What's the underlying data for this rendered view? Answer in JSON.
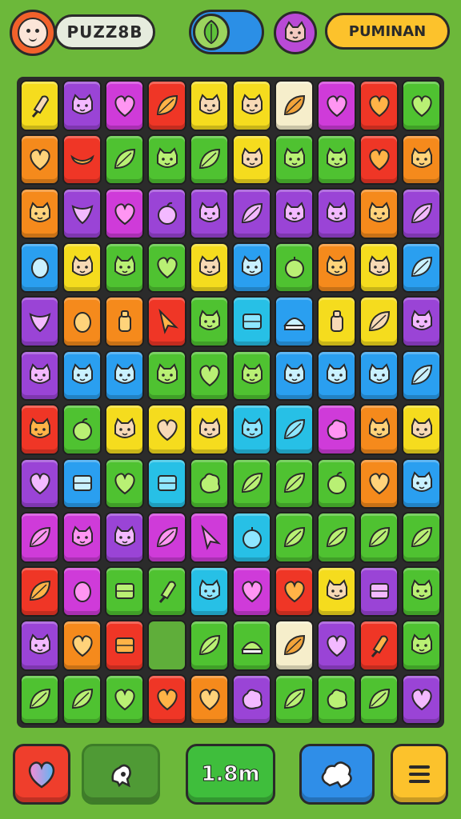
{
  "header": {
    "title": "PUZZ8B",
    "badge": "PUMINAN",
    "colors": {
      "avatar": "#f2612b",
      "toggle": "#2b8fe6",
      "mini_avatar": "#b94ad6",
      "badge": "#fcc22c"
    }
  },
  "board": {
    "rows": 12,
    "cols": 10,
    "tiles": [
      [
        "yellow:popsicle",
        "purple:cat",
        "magenta:heart",
        "red:leaf",
        "yellow:cat",
        "yellow:cat",
        "cream:leaf",
        "magenta:heart",
        "red:heart",
        "green:heart"
      ],
      [
        "orange:heart",
        "red:banana",
        "green:leaf",
        "green:cat",
        "green:leaf",
        "yellow:cat",
        "green:cat",
        "green:cat",
        "red:heart",
        "orange:cat"
      ],
      [
        "orange:cat",
        "purple:bird",
        "magenta:heart",
        "purple:apple",
        "purple:cat",
        "purple:leaf",
        "purple:cat",
        "purple:cat",
        "orange:cat",
        "purple:leaf"
      ],
      [
        "blue:egg",
        "yellow:cat",
        "green:cat",
        "green:heart",
        "yellow:cat",
        "blue:cat",
        "green:plum",
        "orange:cat",
        "yellow:cat",
        "blue:leaf"
      ],
      [
        "purple:bird",
        "orange:egg",
        "orange:bottle",
        "red:arrow",
        "green:cat",
        "cyan:block",
        "blue:slice",
        "yellow:bottle",
        "yellow:leaf",
        "purple:cat"
      ],
      [
        "purple:cat",
        "blue:cat",
        "blue:cat",
        "green:cat",
        "green:heart",
        "green:cat",
        "blue:cat",
        "blue:cat",
        "blue:cat",
        "blue:leaf"
      ],
      [
        "red:cat",
        "green:apple",
        "yellow:cat",
        "yellow:heart",
        "yellow:cat",
        "cyan:cat",
        "cyan:leaf",
        "magenta:blob",
        "orange:cat",
        "yellow:cat"
      ],
      [
        "purple:heart",
        "blue:block",
        "green:heart",
        "cyan:block",
        "green:blob",
        "green:leaf",
        "green:leaf",
        "green:apple",
        "orange:heart",
        "blue:cat"
      ],
      [
        "magenta:leaf",
        "magenta:cat",
        "purple:cat",
        "magenta:leaf",
        "magenta:arrow",
        "cyan:plum",
        "green:leaf",
        "green:leaf",
        "green:leaf",
        "green:leaf"
      ],
      [
        "red:leaf",
        "magenta:egg",
        "green:block",
        "green:popsicle",
        "cyan:cat",
        "magenta:heart",
        "red:heart",
        "yellow:cat",
        "purple:block",
        "green:cat"
      ],
      [
        "purple:cat",
        "orange:heart",
        "red:block",
        "empty:empty",
        "green:leaf",
        "green:slice",
        "cream:leaf",
        "purple:heart",
        "red:popsicle",
        "green:cat"
      ],
      [
        "green:leaf",
        "green:leaf",
        "green:heart",
        "red:heart",
        "orange:heart",
        "purple:blob",
        "green:leaf",
        "green:blob",
        "green:leaf",
        "purple:heart"
      ]
    ],
    "palette": {
      "yellow": "#f5dc1e",
      "purple": "#9a44d6",
      "magenta": "#cf3bd9",
      "red": "#ef3626",
      "green": "#4fc231",
      "orange": "#f58a1c",
      "blue": "#2a9ff0",
      "cyan": "#27c0e6",
      "cream": "#f6eecb"
    }
  },
  "footer": {
    "timer": "1.8m",
    "colors": {
      "heart_button": "#ef3e2c",
      "timer_button": "#3fbe3c",
      "cloud_button": "#2f8ee8",
      "menu_button": "#fcc22c"
    }
  }
}
